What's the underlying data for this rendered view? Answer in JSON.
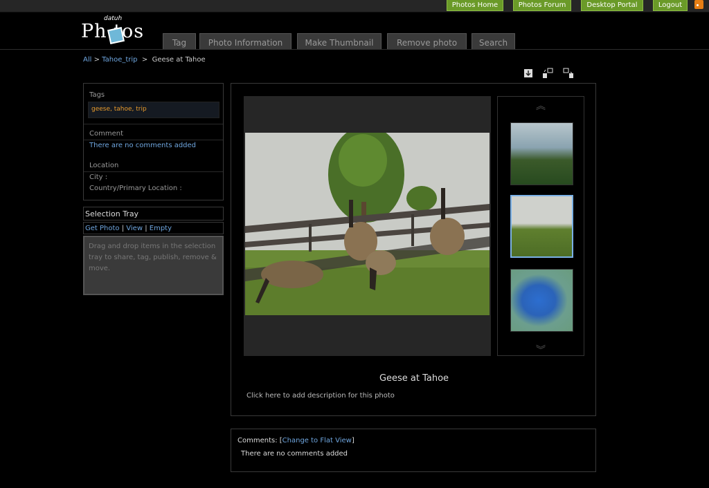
{
  "topnav": {
    "home": "Photos Home",
    "forum": "Photos Forum",
    "portal": "Desktop Portal",
    "logout": "Logout"
  },
  "logo": {
    "small": "datuh",
    "main": "Ph  tos"
  },
  "tabs": [
    "Tag",
    "Photo Information",
    "Make Thumbnail",
    "Remove photo",
    "Search"
  ],
  "breadcrumb": {
    "all": "All",
    "sep": ">",
    "album": "Tahoe_trip",
    "current": "Geese at Tahoe"
  },
  "info": {
    "tags_label": "Tags",
    "tags_value": "geese, tahoe, trip",
    "comment_label": "Comment",
    "comment_value": "There are no comments added",
    "location_label": "Location",
    "city_label": "City :",
    "country_label": "Country/Primary Location :"
  },
  "tray": {
    "title": "Selection Tray",
    "get_photo": "Get Photo",
    "view": "View",
    "empty": "Empty",
    "pipe": "|",
    "hint": "Drag and drop items in the selection tray to share, tag, publish, remove & move."
  },
  "photo": {
    "title": "Geese at Tahoe",
    "description_hint": "Click here to add description for this photo"
  },
  "comments": {
    "label": "Comments:",
    "bracket_open": "[",
    "flat_view": "Change to Flat View",
    "bracket_close": "]",
    "empty": "There are no comments added"
  },
  "colors": {
    "nav_green": "#6a9a28",
    "link_blue": "#6fa6df",
    "tag_orange": "#e89b2c"
  }
}
